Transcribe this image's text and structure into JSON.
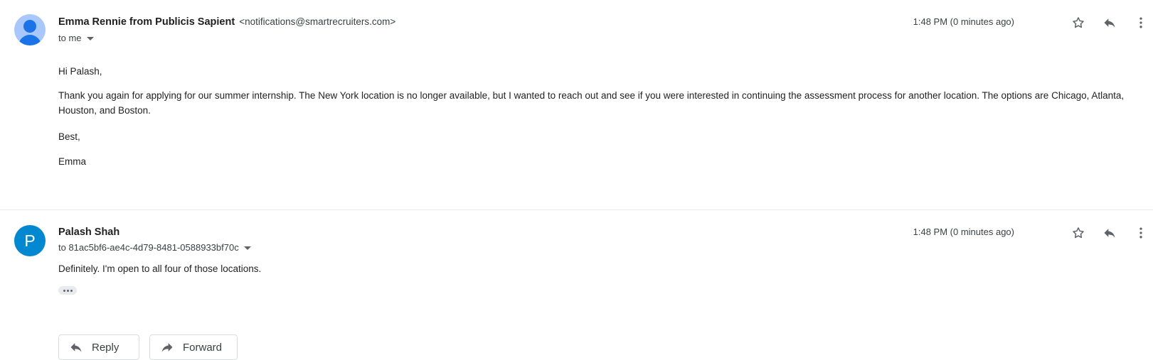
{
  "messages": [
    {
      "sender_name": "Emma Rennie from Publicis Sapient",
      "sender_email": "<notifications@smartrecruiters.com>",
      "recipient": "to me",
      "time": "1:48 PM (0 minutes ago)",
      "avatar_icon": "person-avatar-icon",
      "body": [
        "Hi Palash,",
        "Thank you again for applying for our summer internship. The New York location is no longer available, but I wanted to reach out and see if you were interested in continuing the assessment process for another location. The options are Chicago, Atlanta, Houston, and Boston.",
        "Best,",
        "Emma"
      ]
    },
    {
      "sender_name": "Palash Shah",
      "avatar_letter": "P",
      "recipient": "to 81ac5bf6-ae4c-4d79-8481-0588933bf70c",
      "time": "1:48 PM (0 minutes ago)",
      "body": [
        "Definitely. I'm open to all four of those locations."
      ]
    }
  ],
  "actions": {
    "reply_label": "Reply",
    "forward_label": "Forward"
  },
  "colors": {
    "avatar_default_bg": "#a8c7fa",
    "avatar_default_fg": "#1a73e8",
    "avatar_letter_bg": "#0288d1"
  }
}
